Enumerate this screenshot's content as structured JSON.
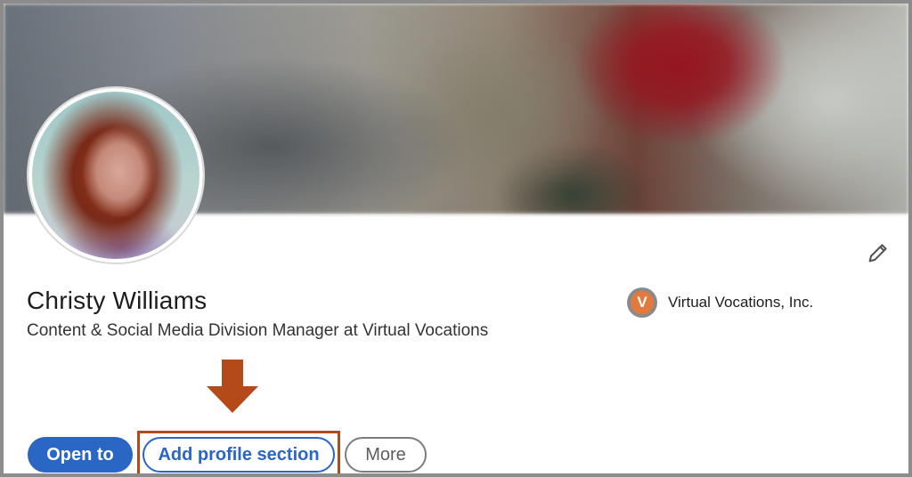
{
  "profile": {
    "name": "Christy Williams",
    "headline": "Content & Social Media Division Manager at Virtual Vocations",
    "company": {
      "name": "Virtual Vocations, Inc.",
      "logo_letter": "V"
    }
  },
  "actions": {
    "open_to_label": "Open to",
    "add_profile_section_label": "Add profile section",
    "more_label": "More"
  },
  "icons": {
    "edit": "pencil-icon",
    "callout": "arrow-down-icon"
  },
  "colors": {
    "primary": "#2a66c3",
    "highlight": "#b4491a",
    "company_logo": "#e27a3e"
  }
}
